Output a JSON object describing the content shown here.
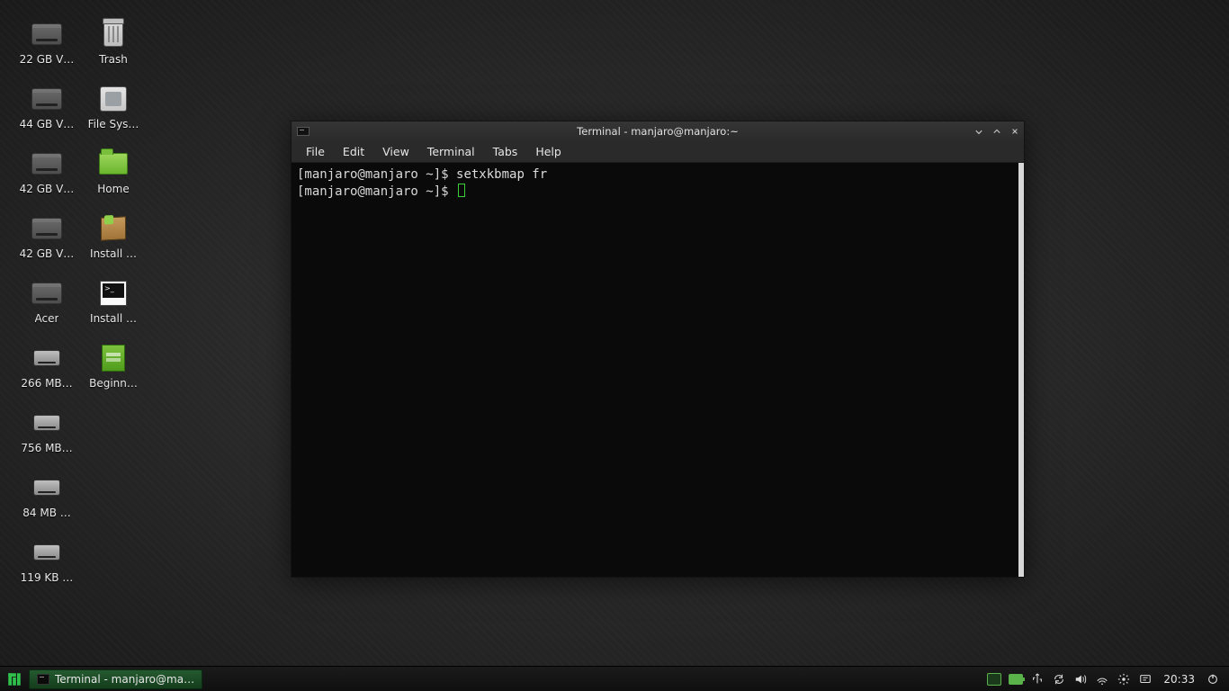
{
  "desktop": {
    "col0": [
      {
        "label": "22 GB V…",
        "icon": "drive"
      },
      {
        "label": "44 GB V…",
        "icon": "drive"
      },
      {
        "label": "42 GB V…",
        "icon": "drive"
      },
      {
        "label": "42 GB V…",
        "icon": "drive"
      },
      {
        "label": "Acer",
        "icon": "drive"
      },
      {
        "label": "266 MB…",
        "icon": "drive-small"
      },
      {
        "label": "756 MB…",
        "icon": "drive-small"
      },
      {
        "label": "84 MB …",
        "icon": "drive-small"
      },
      {
        "label": "119 KB …",
        "icon": "drive-small"
      }
    ],
    "col1": [
      {
        "label": "Trash",
        "icon": "trash"
      },
      {
        "label": "File Sys…",
        "icon": "fs"
      },
      {
        "label": "Home",
        "icon": "folder"
      },
      {
        "label": "Install …",
        "icon": "box"
      },
      {
        "label": "Install …",
        "icon": "termfile"
      },
      {
        "label": "Beginn…",
        "icon": "gdoc"
      }
    ]
  },
  "terminal_window": {
    "title": "Terminal - manjaro@manjaro:~",
    "menus": [
      "File",
      "Edit",
      "View",
      "Terminal",
      "Tabs",
      "Help"
    ],
    "lines": [
      {
        "prompt": "[manjaro@manjaro ~]$ ",
        "text": "setxkbmap fr"
      },
      {
        "prompt": "[manjaro@manjaro ~]$ ",
        "text": "",
        "cursor": true
      }
    ]
  },
  "panel": {
    "task_label": "Terminal - manjaro@ma…",
    "clock": "20:33"
  }
}
